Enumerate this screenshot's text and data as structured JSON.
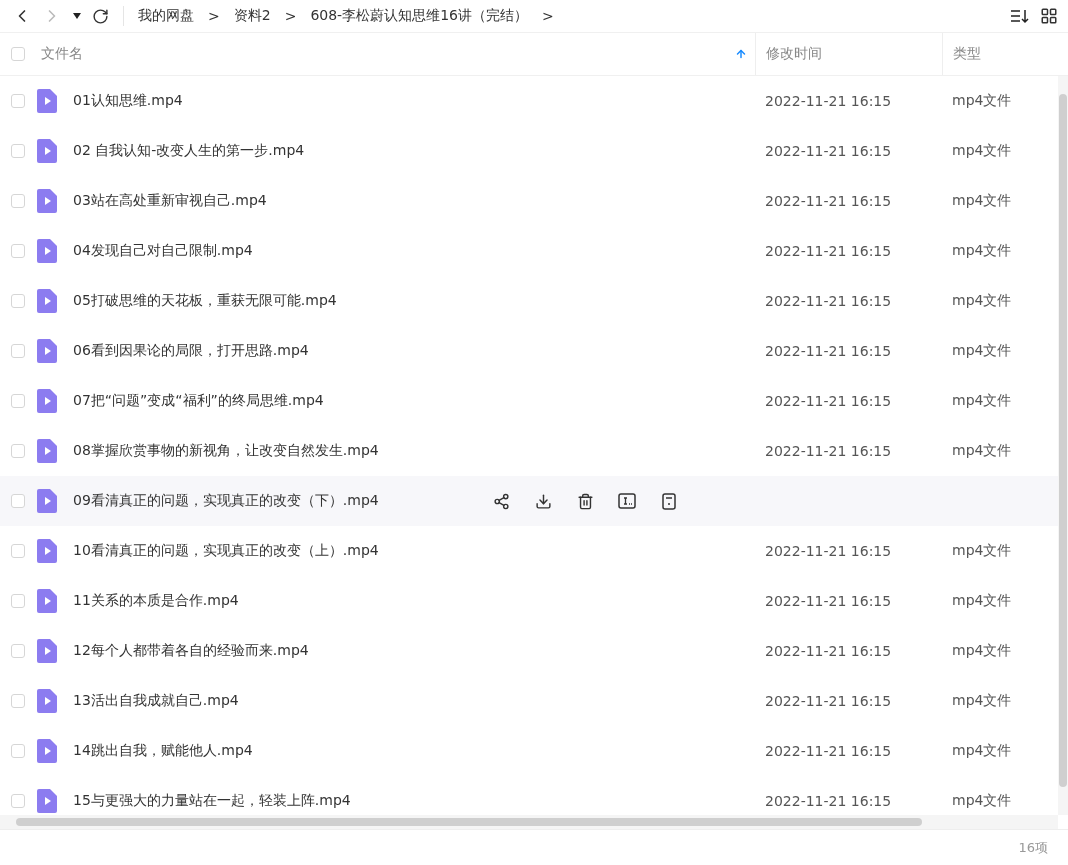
{
  "breadcrumb": [
    "我的网盘",
    "资料2",
    "608-李松蔚认知思维16讲（完结）"
  ],
  "breadcrumb_separator": ">",
  "table": {
    "select_all_checked": false,
    "columns": [
      {
        "label": "文件名",
        "sorted": true
      },
      {
        "label": "修改时间",
        "sorted": false
      },
      {
        "label": "类型",
        "sorted": false
      }
    ],
    "rows": [
      {
        "name": "01认知思维.mp4",
        "modified": "2022-11-21 16:15",
        "type": "mp4文件",
        "hovered": false,
        "checked": false
      },
      {
        "name": "02 自我认知-改变人生的第一步.mp4",
        "modified": "2022-11-21 16:15",
        "type": "mp4文件",
        "hovered": false,
        "checked": false
      },
      {
        "name": "03站在高处重新审视自己.mp4",
        "modified": "2022-11-21 16:15",
        "type": "mp4文件",
        "hovered": false,
        "checked": false
      },
      {
        "name": "04发现自己对自己限制.mp4",
        "modified": "2022-11-21 16:15",
        "type": "mp4文件",
        "hovered": false,
        "checked": false
      },
      {
        "name": "05打破思维的天花板，重获无限可能.mp4",
        "modified": "2022-11-21 16:15",
        "type": "mp4文件",
        "hovered": false,
        "checked": false
      },
      {
        "name": "06看到因果论的局限，打开思路.mp4",
        "modified": "2022-11-21 16:15",
        "type": "mp4文件",
        "hovered": false,
        "checked": false
      },
      {
        "name": "07把“问题”变成“福利”的终局思维.mp4",
        "modified": "2022-11-21 16:15",
        "type": "mp4文件",
        "hovered": false,
        "checked": false
      },
      {
        "name": "08掌握欣赏事物的新视角，让改变自然发生.mp4",
        "modified": "2022-11-21 16:15",
        "type": "mp4文件",
        "hovered": false,
        "checked": false
      },
      {
        "name": "09看清真正的问题，实现真正的改变（下）.mp4",
        "hovered": true,
        "checked": false
      },
      {
        "name": "10看清真正的问题，实现真正的改变（上）.mp4",
        "modified": "2022-11-21 16:15",
        "type": "mp4文件",
        "hovered": false,
        "checked": false
      },
      {
        "name": "11关系的本质是合作.mp4",
        "modified": "2022-11-21 16:15",
        "type": "mp4文件",
        "hovered": false,
        "checked": false
      },
      {
        "name": "12每个人都带着各自的经验而来.mp4",
        "modified": "2022-11-21 16:15",
        "type": "mp4文件",
        "hovered": false,
        "checked": false
      },
      {
        "name": "13活出自我成就自己.mp4",
        "modified": "2022-11-21 16:15",
        "type": "mp4文件",
        "hovered": false,
        "checked": false
      },
      {
        "name": "14跳出自我，赋能他人.mp4",
        "modified": "2022-11-21 16:15",
        "type": "mp4文件",
        "hovered": false,
        "checked": false
      },
      {
        "name": "15与更强大的力量站在一起，轻装上阵.mp4",
        "modified": "2022-11-21 16:15",
        "type": "mp4文件",
        "hovered": false,
        "checked": false
      }
    ]
  },
  "status_bar": {
    "count": "16项"
  }
}
